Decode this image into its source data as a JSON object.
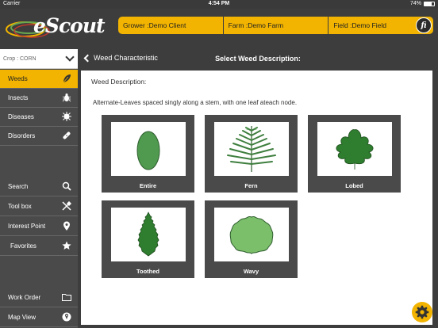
{
  "status_bar": {
    "carrier": "Carrier",
    "time": "4:54 PM",
    "battery": "74%",
    "battery_level": 0.74
  },
  "header": {
    "logo_text": "eScout",
    "grower": "Grower :Demo Client",
    "farm": "Farm :Demo Farm",
    "field": "Field :Demo Field",
    "info_label": "fi"
  },
  "sidebar": {
    "crop": "Crop : CORN",
    "items": [
      {
        "label": "Weeds",
        "icon": "leaf-icon"
      },
      {
        "label": "Insects",
        "icon": "bug-icon"
      },
      {
        "label": "Diseases",
        "icon": "virus-icon"
      },
      {
        "label": "Disorders",
        "icon": "bandage-icon"
      },
      {
        "label": "Search",
        "icon": "search-icon"
      },
      {
        "label": "Tool box",
        "icon": "tools-icon"
      },
      {
        "label": "Interest Point",
        "icon": "map-pin-icon"
      },
      {
        "label": "Favorites",
        "icon": "star-icon"
      },
      {
        "label": "Work Order",
        "icon": "folder-icon"
      },
      {
        "label": "Map View",
        "icon": "map-icon"
      }
    ]
  },
  "main": {
    "back_label": "Weed Characteristic",
    "title": "Select Weed Description:",
    "desc_label": "Weed Description:",
    "desc_text": "Alternate-Leaves spaced singly along a stem, with one leaf ateach node.",
    "cards": [
      {
        "label": "Entire"
      },
      {
        "label": "Fern"
      },
      {
        "label": "Lobed"
      },
      {
        "label": "Toothed"
      },
      {
        "label": "Wavy"
      }
    ]
  },
  "colors": {
    "accent": "#f2b400",
    "chrome": "#3d3d3d",
    "leaf": "#4f9a4f"
  }
}
